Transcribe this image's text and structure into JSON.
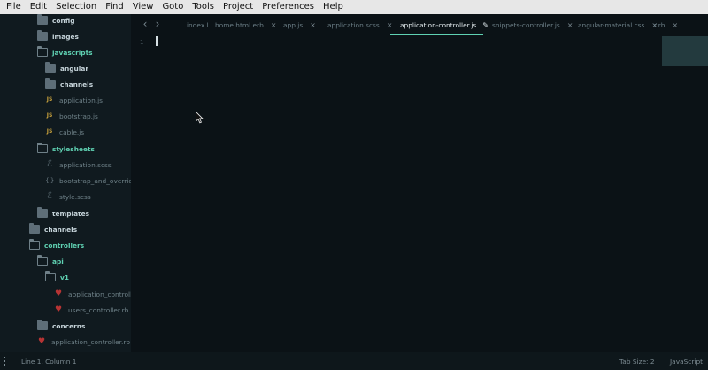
{
  "menu": [
    "File",
    "Edit",
    "Selection",
    "Find",
    "View",
    "Goto",
    "Tools",
    "Project",
    "Preferences",
    "Help"
  ],
  "sidebar": {
    "items": [
      {
        "label": "config",
        "kind": "folder",
        "open": false,
        "icon": "folder-icon"
      },
      {
        "label": "images",
        "kind": "folder",
        "open": false,
        "icon": "folder-icon"
      },
      {
        "label": "javascripts",
        "kind": "folder",
        "open": true,
        "icon": "folder-open-icon"
      },
      {
        "label": "angular",
        "kind": "folder",
        "open": false,
        "icon": "folder-icon"
      },
      {
        "label": "channels",
        "kind": "folder",
        "open": false,
        "icon": "folder-icon"
      },
      {
        "label": "application.js",
        "kind": "file",
        "icon": "js-file-icon"
      },
      {
        "label": "bootstrap.js",
        "kind": "file",
        "icon": "js-file-icon"
      },
      {
        "label": "cable.js",
        "kind": "file",
        "icon": "js-file-icon"
      },
      {
        "label": "stylesheets",
        "kind": "folder",
        "open": true,
        "icon": "folder-open-icon"
      },
      {
        "label": "application.scss",
        "kind": "file",
        "icon": "sass-file-icon"
      },
      {
        "label": "bootstrap_and_overrides.c",
        "kind": "file",
        "icon": "css-file-icon"
      },
      {
        "label": "style.scss",
        "kind": "file",
        "icon": "sass-file-icon"
      },
      {
        "label": "templates",
        "kind": "folder",
        "open": false,
        "icon": "folder-icon"
      },
      {
        "label": "channels",
        "kind": "folder",
        "open": false,
        "icon": "folder-icon"
      },
      {
        "label": "controllers",
        "kind": "folder",
        "open": true,
        "icon": "folder-open-icon"
      },
      {
        "label": "api",
        "kind": "folder",
        "open": true,
        "icon": "folder-open-icon"
      },
      {
        "label": "v1",
        "kind": "folder",
        "open": true,
        "icon": "folder-open-icon"
      },
      {
        "label": "application_controller.r",
        "kind": "file",
        "icon": "ruby-file-icon"
      },
      {
        "label": "users_controller.rb",
        "kind": "file",
        "icon": "ruby-file-icon"
      },
      {
        "label": "concerns",
        "kind": "folder",
        "open": false,
        "icon": "folder-icon"
      },
      {
        "label": "application_controller.rb",
        "kind": "file",
        "icon": "ruby-file-icon"
      }
    ]
  },
  "tabs": [
    {
      "label": "index.l",
      "active": false,
      "close": ""
    },
    {
      "label": "home.html.erb",
      "active": false,
      "close": "×"
    },
    {
      "label": "app.js",
      "active": false,
      "close": "×"
    },
    {
      "label": "application.scss",
      "active": false,
      "close": "×"
    },
    {
      "label": "application-controller.js",
      "active": true,
      "close": ""
    },
    {
      "label": "snippets-controller.js",
      "active": false,
      "close": "×"
    },
    {
      "label": "angular-material.css",
      "active": false,
      "close": "×"
    },
    {
      "label": "r.rb",
      "active": false,
      "close": "×"
    }
  ],
  "editor": {
    "line_numbers": [
      "1"
    ]
  },
  "status": {
    "position": "Line 1, Column 1",
    "tab_size": "Tab Size: 2",
    "syntax": "JavaScript"
  },
  "colors": {
    "accent": "#5fd1b2",
    "background": "#0b1216",
    "sidebar": "#101a1f",
    "ruby": "#b83434",
    "js": "#c9a23c"
  }
}
